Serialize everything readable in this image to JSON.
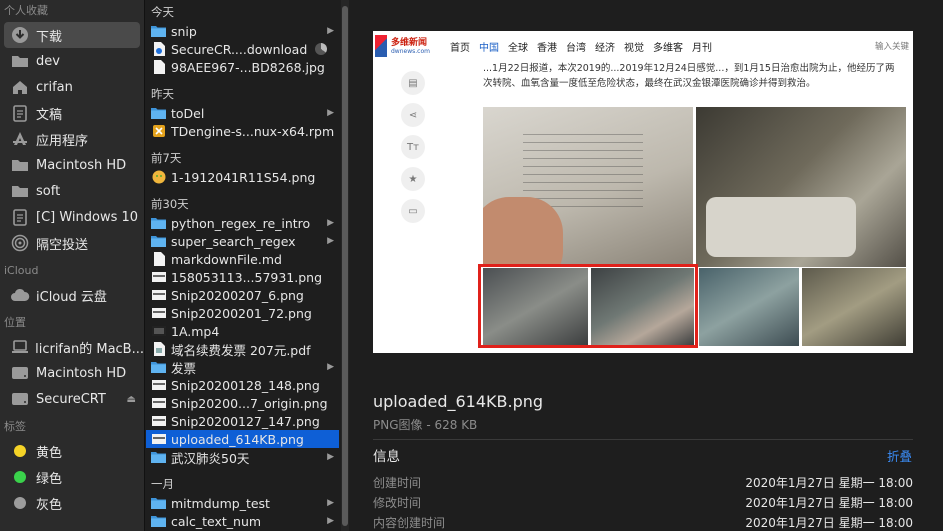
{
  "sidebar": {
    "sections": [
      {
        "title": "个人收藏",
        "items": [
          {
            "label": "下载",
            "icon": "download-icon",
            "active": true
          },
          {
            "label": "dev",
            "icon": "folder-icon"
          },
          {
            "label": "crifan",
            "icon": "home-icon"
          },
          {
            "label": "文稿",
            "icon": "document-icon"
          },
          {
            "label": "应用程序",
            "icon": "applications-icon"
          },
          {
            "label": "Macintosh HD",
            "icon": "folder-icon"
          },
          {
            "label": "soft",
            "icon": "folder-icon"
          },
          {
            "label": "[C] Windows 10",
            "icon": "document-icon"
          },
          {
            "label": "隔空投送",
            "icon": "airdrop-icon"
          }
        ]
      },
      {
        "title": "iCloud",
        "items": [
          {
            "label": "iCloud 云盘",
            "icon": "cloud-icon"
          }
        ]
      },
      {
        "title": "位置",
        "items": [
          {
            "label": "licrifan的 MacB...",
            "icon": "laptop-icon"
          },
          {
            "label": "Macintosh HD",
            "icon": "disk-icon"
          },
          {
            "label": "SecureCRT",
            "icon": "disk-icon",
            "eject": true
          }
        ]
      },
      {
        "title": "标签",
        "items": [
          {
            "label": "黄色",
            "color": "#f5d327"
          },
          {
            "label": "绿色",
            "color": "#3ad24b"
          },
          {
            "label": "灰色",
            "color": "#9c9c9c"
          }
        ]
      }
    ]
  },
  "files": {
    "groups": [
      {
        "title": "今天",
        "items": [
          {
            "name": "snip",
            "type": "folder",
            "chevron": true
          },
          {
            "name": "SecureCR....download",
            "type": "download",
            "progress": 0.35
          },
          {
            "name": "98AEE967-...BD8268.jpg",
            "type": "file"
          }
        ]
      },
      {
        "title": "昨天",
        "items": [
          {
            "name": "toDel",
            "type": "folder",
            "chevron": true
          },
          {
            "name": "TDengine-s...nux-x64.rpm",
            "type": "rpm"
          }
        ]
      },
      {
        "title": "前7天",
        "items": [
          {
            "name": "1-1912041R11S54.png",
            "type": "image-face"
          }
        ]
      },
      {
        "title": "前30天",
        "items": [
          {
            "name": "python_regex_re_intro",
            "type": "folder",
            "chevron": true
          },
          {
            "name": "super_search_regex",
            "type": "folder",
            "chevron": true
          },
          {
            "name": "markdownFile.md",
            "type": "file"
          },
          {
            "name": "158053113...57931.png",
            "type": "image"
          },
          {
            "name": "Snip20200207_6.png",
            "type": "image"
          },
          {
            "name": "Snip20200201_72.png",
            "type": "image"
          },
          {
            "name": "1A.mp4",
            "type": "video"
          },
          {
            "name": "域名续费发票 207元.pdf",
            "type": "pdf"
          },
          {
            "name": "发票",
            "type": "folder",
            "chevron": true
          },
          {
            "name": "Snip20200128_148.png",
            "type": "image"
          },
          {
            "name": "Snip20200...7_origin.png",
            "type": "image"
          },
          {
            "name": "Snip20200127_147.png",
            "type": "image"
          },
          {
            "name": "uploaded_614KB.png",
            "type": "image",
            "selected": true
          },
          {
            "name": "武汉肺炎50天",
            "type": "folder",
            "chevron": true
          }
        ]
      },
      {
        "title": "一月",
        "items": [
          {
            "name": "mitmdump_test",
            "type": "folder",
            "chevron": true
          },
          {
            "name": "calc_text_num",
            "type": "folder",
            "chevron": true
          }
        ]
      }
    ]
  },
  "preview": {
    "web": {
      "logo": "多维新闻",
      "logo_sub": "dwnews.com",
      "nav": [
        "首页",
        "中国",
        "全球",
        "香港",
        "台湾",
        "经济",
        "视觉",
        "多维客",
        "月刊"
      ],
      "nav_current": "中国",
      "login": "输入关键",
      "text": "...1月22日报道，本次2019的...2019年12月24日感觉...，到1月15日治愈出院为止，他经历了两次转院、血氧含量一度低至危险状态，最终在武汉金银潭医院确诊并得到救治。"
    },
    "title": "uploaded_614KB.png",
    "subtitle": "PNG图像 - 628 KB",
    "info_label": "信息",
    "fold_label": "折叠",
    "rows": [
      {
        "key": "创建时间",
        "value": "2020年1月27日 星期一 18:00"
      },
      {
        "key": "修改时间",
        "value": "2020年1月27日 星期一 18:00"
      },
      {
        "key": "内容创建时间",
        "value": "2020年1月27日 星期一 18:00"
      }
    ]
  }
}
